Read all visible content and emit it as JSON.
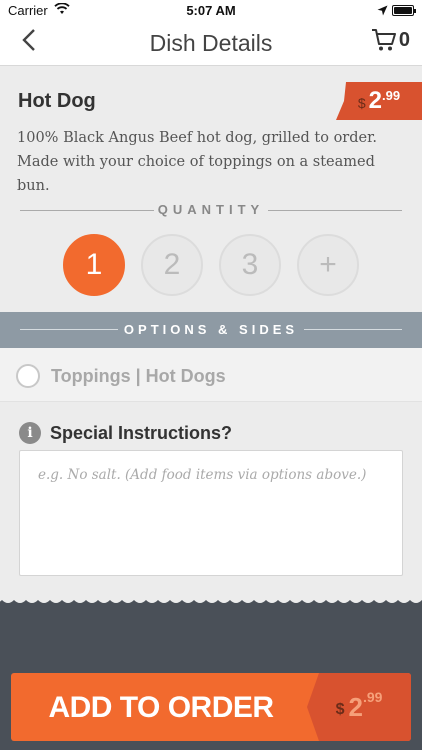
{
  "status_bar": {
    "carrier": "Carrier",
    "time": "5:07 AM"
  },
  "nav": {
    "title": "Dish Details",
    "back_icon": "chevron-left-icon",
    "cart_icon": "cart-icon",
    "cart_count": "0"
  },
  "dish": {
    "name": "Hot Dog",
    "price_symbol": "$",
    "price_main": "2",
    "price_cents": ".99",
    "description": "100% Black Angus Beef hot dog, grilled to order. Made with your choice of toppings on a steamed bun."
  },
  "quantity": {
    "label": "QUANTITY",
    "options": [
      "1",
      "2",
      "3",
      "+"
    ],
    "selected": "1"
  },
  "options": {
    "header": "OPTIONS & SIDES",
    "items": [
      {
        "label": "Toppings | Hot Dogs",
        "selected": false
      }
    ]
  },
  "special": {
    "info_icon": "info-icon",
    "label": "Special Instructions?",
    "placeholder": "e.g. No salt. (Add food items via options above.)"
  },
  "add_button": {
    "label": "ADD TO ORDER",
    "price_symbol": "$",
    "price_main": "2",
    "price_cents": ".99"
  },
  "colors": {
    "accent": "#f26a2e",
    "accent_dark": "#d8522f",
    "header_gray": "#8e9aa4",
    "footer": "#4a5058"
  }
}
